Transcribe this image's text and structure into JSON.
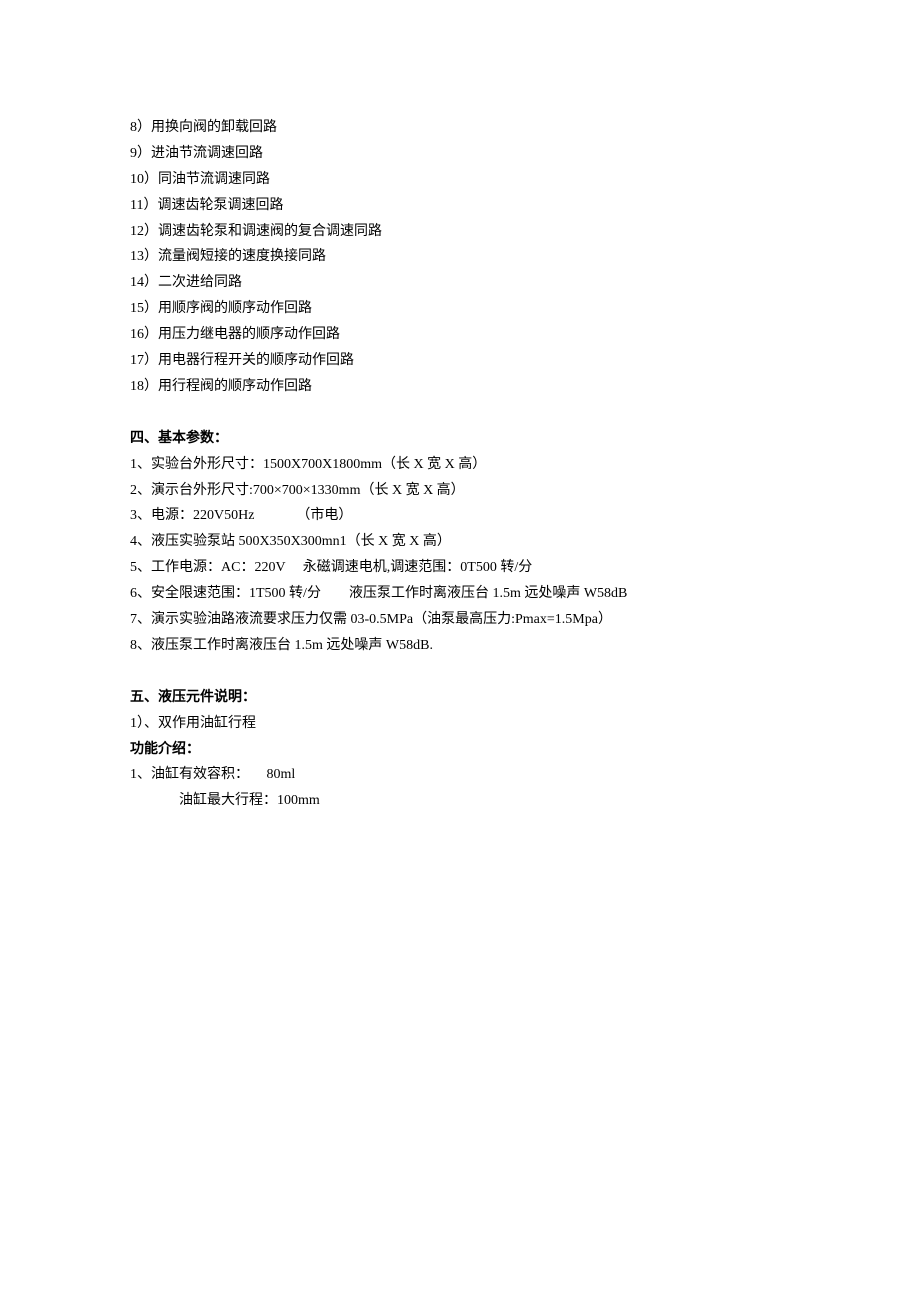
{
  "list1": [
    "8）用换向阀的卸载回路",
    "9）进油节流调速回路",
    "10）同油节流调速同路",
    "11）调速齿轮泵调速回路",
    "12）调速齿轮泵和调速阀的复合调速同路",
    "13）流量阀短接的速度换接同路",
    "14）二次进给同路",
    "15）用顺序阀的顺序动作回路",
    "16）用压力继电器的顺序动作回路",
    "17）用电器行程开关的顺序动作回路",
    "18）用行程阀的顺序动作回路"
  ],
  "section4": {
    "heading": "四、基本参数：",
    "items": [
      "1、实验台外形尺寸：1500X700X1800mm（长 X 宽 X 高）",
      "2、演示台外形尺寸:700×700×1330mm（长 X 宽 X 高）",
      "3、电源：220V50Hz            （市电）",
      "4、液压实验泵站 500X350X300mn1（长 X 宽 X 高）",
      "5、工作电源：AC：220V     永磁调速电机,调速范围：0T500 转/分",
      "6、安全限速范围：1T500 转/分        液压泵工作时离液压台 1.5m 远处噪声 W58dB",
      "7、演示实验油路液流要求压力仅需 03-0.5MPa（油泵最高压力:Pmax=1.5Mpa）",
      "8、液压泵工作时离液压台 1.5m 远处噪声 W58dB."
    ]
  },
  "section5": {
    "heading": "五、液压元件说明：",
    "line1": "1）、双作用油缸行程",
    "sub_heading": "功能介绍：",
    "line2": "1、油缸有效容积：     80ml",
    "line3": "油缸最大行程：100mm"
  }
}
